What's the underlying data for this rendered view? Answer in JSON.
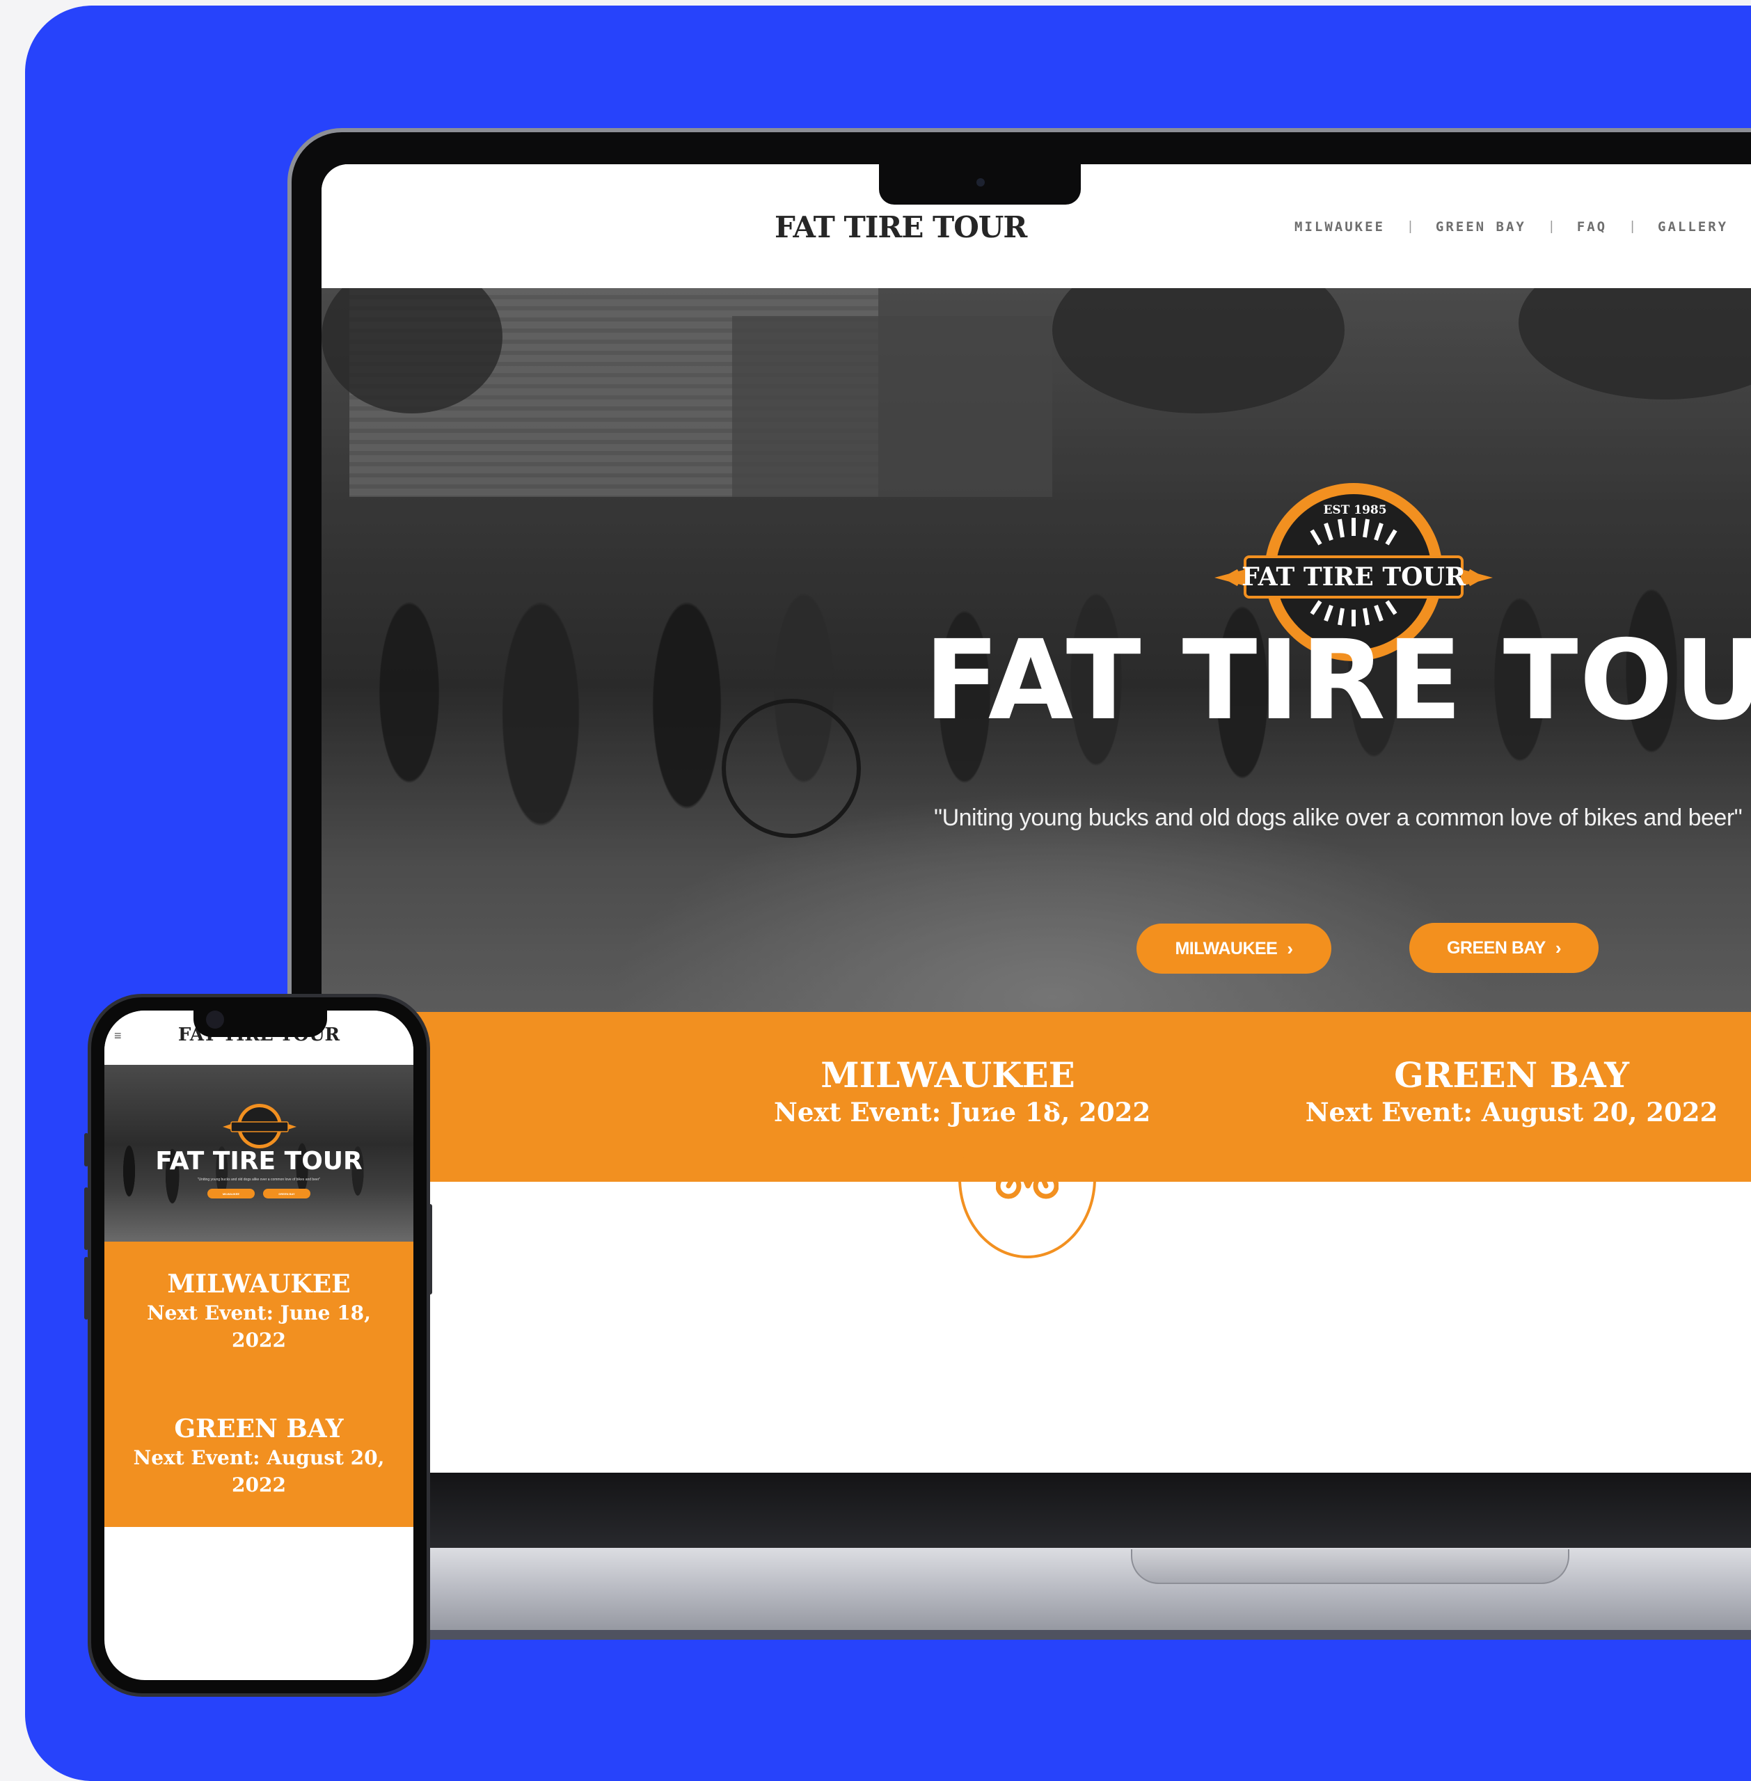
{
  "colors": {
    "background": "#2743fb",
    "accent": "#f29020",
    "header_text": "#262626",
    "nav_text": "#6e6e6e"
  },
  "desktop": {
    "logo_text": "FAT TIRE TOUR",
    "nav": {
      "items": [
        "MILWAUKEE",
        "GREEN BAY",
        "FAQ",
        "GALLERY"
      ],
      "separator": "|"
    },
    "hero": {
      "badge_est": "EST 1985",
      "badge_text": "FAT TIRE TOUR",
      "title": "FAT TIRE TOUR",
      "tagline": "\"Uniting young bucks and old dogs alike over a common love of bikes and beer\"",
      "buttons": [
        {
          "label": "MILWAUKEE",
          "icon": "chevron-right-icon"
        },
        {
          "label": "GREEN BAY",
          "icon": "chevron-right-icon"
        }
      ]
    },
    "events": [
      {
        "city": "MILWAUKEE",
        "next_event": "Next Event: June 18, 2022"
      },
      {
        "city": "GREEN BAY",
        "next_event": "Next Event: August 20, 2022"
      }
    ],
    "feature_icon": "bicycle-icon"
  },
  "mobile": {
    "menu_icon": "hamburger-icon",
    "logo_text": "FAT TIRE TOUR",
    "hero": {
      "title": "FAT TIRE TOUR",
      "tagline": "\"Uniting young bucks and old dogs alike over a common love of bikes and beer\"",
      "buttons": [
        {
          "label": "MILWAUKEE"
        },
        {
          "label": "GREEN BAY"
        }
      ]
    },
    "events": [
      {
        "city": "MILWAUKEE",
        "next_event_line1": "Next Event: June 18,",
        "next_event_line2": "2022"
      },
      {
        "city": "GREEN BAY",
        "next_event_line1": "Next Event: August 20,",
        "next_event_line2": "2022"
      }
    ]
  }
}
